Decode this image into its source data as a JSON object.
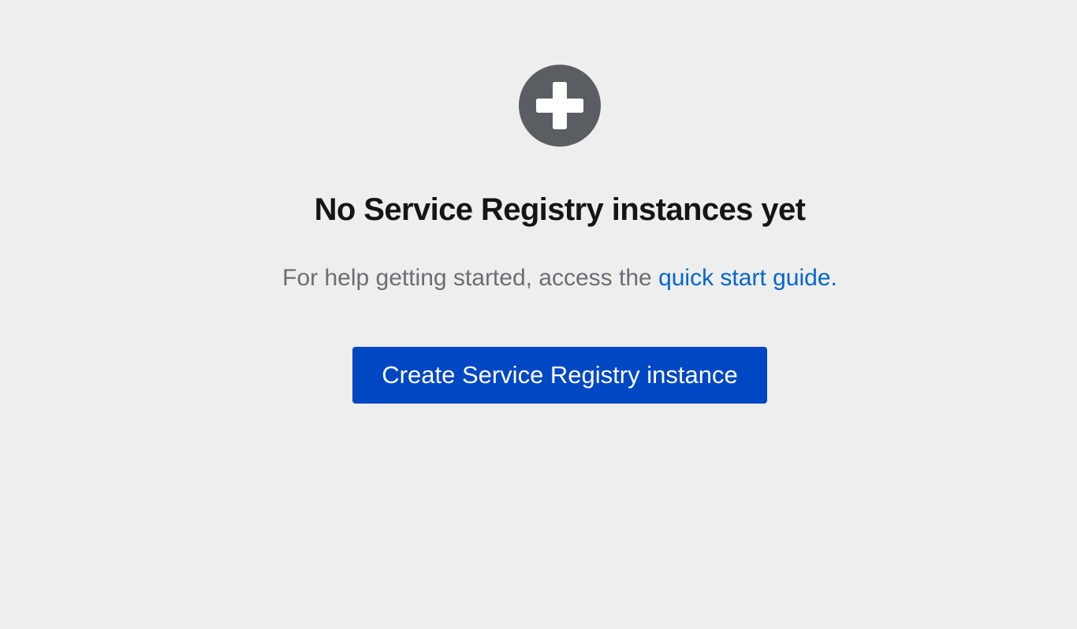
{
  "empty_state": {
    "icon": "plus-circle-icon",
    "title": "No Service Registry instances yet",
    "body_prefix": "For help getting started, access the ",
    "link_label": "quick start guide.",
    "button_label": "Create Service Registry instance"
  },
  "colors": {
    "background": "#eeeeee",
    "icon": "#5a5e63",
    "title": "#151515",
    "body": "#6a6e73",
    "link": "#0066cc",
    "button_bg": "#0047c4",
    "button_text": "#ffffff"
  }
}
